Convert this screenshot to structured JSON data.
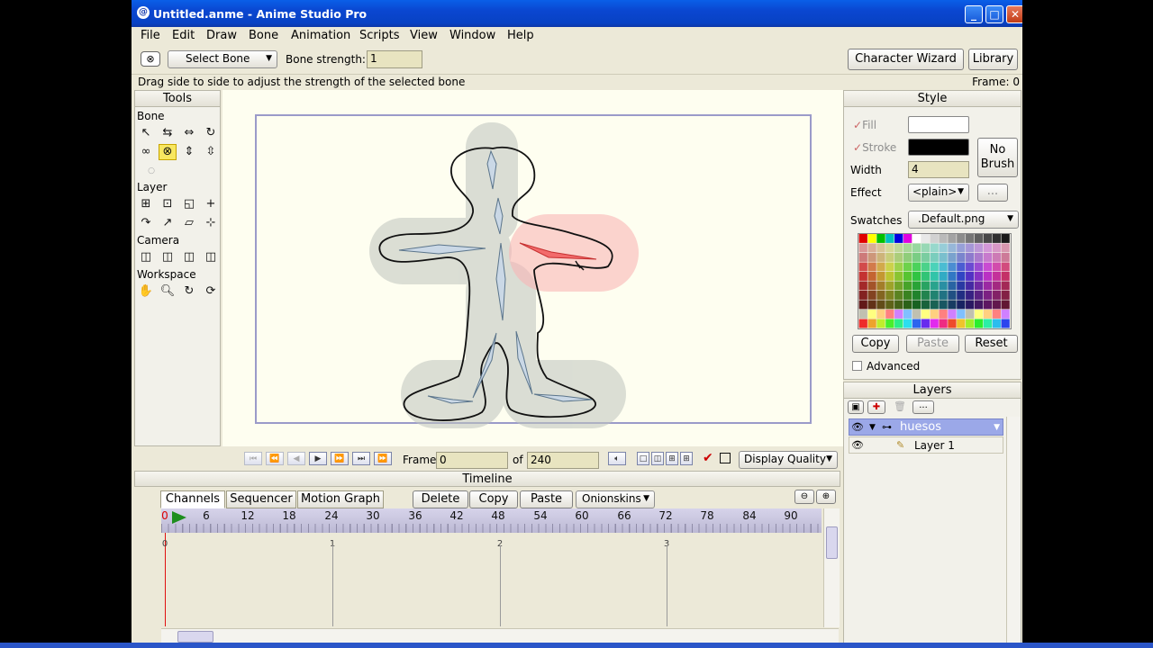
{
  "window": {
    "title": "Untitled.anme - Anime Studio Pro"
  },
  "menu": [
    "File",
    "Edit",
    "Draw",
    "Bone",
    "Animation",
    "Scripts",
    "View",
    "Window",
    "Help"
  ],
  "toolbar": {
    "tool_select": "Select Bone",
    "bone_strength_label": "Bone strength:",
    "bone_strength_value": "1",
    "character_wizard": "Character Wizard",
    "library": "Library"
  },
  "status": {
    "hint": "Drag side to side to adjust the strength of the selected bone",
    "frame": "Frame: 0"
  },
  "tools": {
    "title": "Tools",
    "sections": [
      "Bone",
      "Layer",
      "Camera",
      "Workspace"
    ]
  },
  "playback": {
    "frame_label": "Frame",
    "frame_value": "0",
    "of_label": "of",
    "total_value": "240",
    "display_quality": "Display Quality"
  },
  "timeline": {
    "title": "Timeline",
    "tabs": [
      "Channels",
      "Sequencer",
      "Motion Graph"
    ],
    "buttons": [
      "Delete",
      "Copy",
      "Paste"
    ],
    "onionskins": "Onionskins",
    "ruler": [
      "0",
      "6",
      "12",
      "18",
      "24",
      "30",
      "36",
      "42",
      "48",
      "54",
      "60",
      "66",
      "72",
      "78",
      "84",
      "90"
    ],
    "seconds": [
      "0",
      "1",
      "2",
      "3"
    ]
  },
  "style": {
    "title": "Style",
    "fill_label": "Fill",
    "stroke_label": "Stroke",
    "width_label": "Width",
    "width_value": "4",
    "effect_label": "Effect",
    "effect_value": "<plain>",
    "effect_more": "...",
    "no_brush": "No Brush",
    "swatches_label": "Swatches",
    "swatches_value": ".Default.png",
    "copy": "Copy",
    "paste": "Paste",
    "reset": "Reset",
    "advanced": "Advanced",
    "fill_color": "#FFFFFF",
    "stroke_color": "#000000"
  },
  "layers": {
    "title": "Layers",
    "items": [
      {
        "name": "huesos"
      },
      {
        "name": "Layer 1"
      }
    ],
    "more": "..."
  }
}
